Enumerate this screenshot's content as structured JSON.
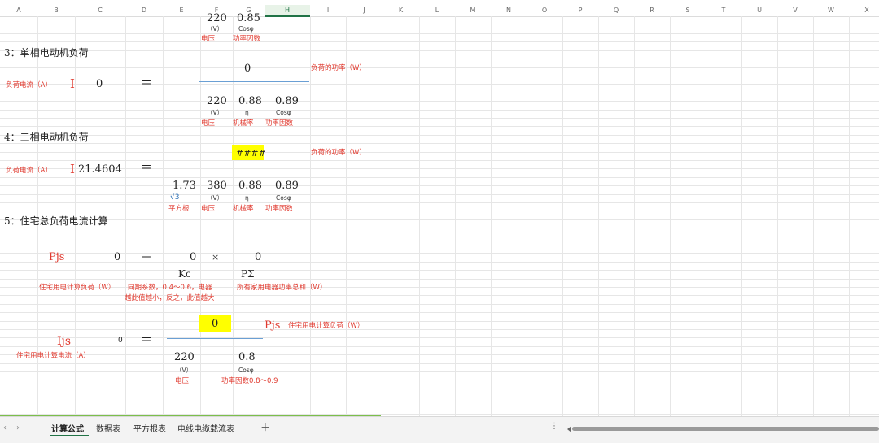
{
  "columns": [
    "A",
    "B",
    "C",
    "D",
    "E",
    "F",
    "G",
    "H",
    "I",
    "J",
    "K",
    "L",
    "M",
    "N",
    "O",
    "P",
    "Q",
    "R",
    "S",
    "T",
    "U",
    "V",
    "W",
    "X"
  ],
  "selected_column": "H",
  "accent_color": "#217346",
  "highlight_color": "#ffff00",
  "formula_red": "#e03a2f",
  "block_top": {
    "voltage": "220",
    "cos_value": "0.85",
    "unit_v": "（V）",
    "cos_label": "Cosφ",
    "lbl_voltage": "电压",
    "lbl_pf": "功率因数"
  },
  "s3": {
    "title": "3：单相电动机负荷",
    "current_label": "负荷电流（A）",
    "symbol": "I",
    "current": "0",
    "eq": "＝",
    "power": "0",
    "power_note": "负荷的功率（W）",
    "voltage": "220",
    "eta": "0.88",
    "cos": "0.89",
    "unit_v": "（V）",
    "eta_sym": "η",
    "cos_label": "Cosφ",
    "lbl_voltage": "电压",
    "lbl_eff": "机械率",
    "lbl_pf": "功率因数"
  },
  "s4": {
    "title": "4：三相电动机负荷",
    "current_label": "负荷电流（A）",
    "symbol": "I",
    "current": "21.4604",
    "eq": "＝",
    "power": "####",
    "power_note": "负荷的功率（W）",
    "sqrt_val": "1.73",
    "sqrt_sym": "√3",
    "voltage": "380",
    "eta": "0.88",
    "cos": "0.89",
    "unit_v": "（V）",
    "eta_sym": "η",
    "cos_label": "Cosφ",
    "lbl_sqrt": "平方根",
    "lbl_voltage": "电压",
    "lbl_eff": "机械率",
    "lbl_pf": "功率因数"
  },
  "s5": {
    "title": "5：住宅总负荷电流计算",
    "pjs": "Pjs",
    "pjs_value": "0",
    "eq": "＝",
    "kc_value": "0",
    "times": "×",
    "psum_value": "0",
    "kc_label": "Kc",
    "psum_label": "PΣ",
    "pjs_desc": "住宅用电计算负荷（W）",
    "kc_desc_1": "同期系数，0.4～0.6，电器",
    "kc_desc_2": "越此值越小，反之，此值越大",
    "psum_desc": "所有家用电器功率总和（W）",
    "numerator": "0",
    "pjs2": "Pjs",
    "pjs2_desc": "住宅用电计算负荷（W）",
    "ijs": "Ijs",
    "ijs_value": "0",
    "eq2": "＝",
    "ijs_desc": "住宅用电计算电流（A）",
    "voltage": "220",
    "cos": "0.8",
    "unit_v": "（V）",
    "cos_label": "Cosφ",
    "lbl_voltage": "电压",
    "lbl_pf": "功率因数0.8～0.9"
  },
  "tabs": [
    "计算公式",
    "数据表",
    "平方根表",
    "电线电缆载流表"
  ],
  "add_tab": "＋",
  "nav_prev": "‹",
  "nav_next": "›",
  "more": "⋮"
}
